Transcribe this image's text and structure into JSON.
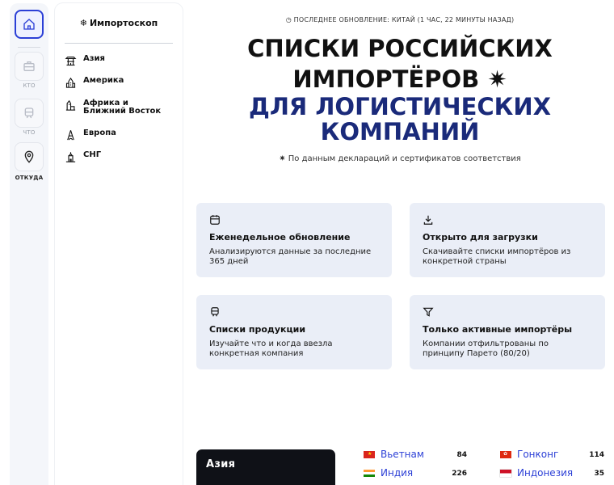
{
  "rail": {
    "items": [
      {
        "label": "",
        "icon": "home-icon"
      },
      {
        "label": "КТО",
        "icon": "briefcase-icon"
      },
      {
        "label": "ЧТО",
        "icon": "train-icon"
      },
      {
        "label": "ОТКУДА",
        "icon": "map-pin-icon"
      }
    ]
  },
  "sidebar": {
    "title": "Импортоскоп",
    "regions": [
      {
        "label": "Азия",
        "icon": "pagoda-icon"
      },
      {
        "label": "Америка",
        "icon": "skyscraper-icon"
      },
      {
        "label": "Африка и Ближний Восток",
        "icon": "sphinx-icon"
      },
      {
        "label": "Европа",
        "icon": "eiffel-tower-icon"
      },
      {
        "label": "СНГ",
        "icon": "kremlin-icon"
      }
    ]
  },
  "header": {
    "update": "ПОСЛЕДНЕЕ ОБНОВЛЕНИЕ: КИТАЙ (1 ЧАС, 22 МИНУТЫ НАЗАД)",
    "title_line1": "СПИСКИ РОССИЙСКИХ",
    "title_line2": "ИМПОРТЁРОВ ✷",
    "title_line3": "ДЛЯ ЛОГИСТИЧЕСКИХ",
    "title_line4": "КОМПАНИЙ",
    "subtitle": "✷ По данным деклараций и сертификатов соответствия"
  },
  "cards": [
    {
      "icon": "calendar-icon",
      "title": "Еженедельное обновление",
      "text": "Анализируются данные за последние 365 дней"
    },
    {
      "icon": "download-icon",
      "title": "Открыто для загрузки",
      "text": "Скачивайте списки импортёров из конкретной страны"
    },
    {
      "icon": "train-icon",
      "title": "Списки продукции",
      "text": "Изучайте что и когда ввезла конкретная компания"
    },
    {
      "icon": "filter-icon",
      "title": "Только активные импортёры",
      "text": "Компании отфильтрованы по принципу Парето (80/20)"
    }
  ],
  "region_tile": {
    "label": "Азия"
  },
  "countries": [
    {
      "name": "Вьетнам",
      "count": "84"
    },
    {
      "name": "Гонконг",
      "count": "114"
    },
    {
      "name": "Индия",
      "count": "226"
    },
    {
      "name": "Индонезия",
      "count": "35"
    }
  ],
  "colors": {
    "accent": "#2b3fd6",
    "title_blue": "#1a2a7a",
    "card_bg": "#eaeef7"
  }
}
